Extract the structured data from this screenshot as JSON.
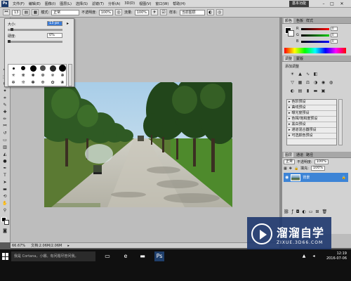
{
  "menubar": {
    "logo": "Ps",
    "items": [
      "文件(F)",
      "编辑(E)",
      "图像(I)",
      "图层(L)",
      "选择(S)",
      "滤镜(T)",
      "分析(A)",
      "3D(D)",
      "视图(V)",
      "窗口(W)",
      "帮助(H)"
    ],
    "workspace": "基本功能",
    "win_min": "–",
    "win_max": "□",
    "win_close": "✕"
  },
  "options": {
    "brush_size": "13",
    "mode_label": "模式:",
    "mode_value": "正常",
    "opacity_label": "不透明度:",
    "opacity_value": "100%",
    "flow_label": "流量:",
    "flow_value": "100%",
    "sample_label": "样本:",
    "sample_value": "当前图层"
  },
  "brush_popup": {
    "size_label": "大小:",
    "size_value": "13 px",
    "hardness_label": "硬度:",
    "hardness_value": "0%",
    "size_fraction": 0.05,
    "hardness_fraction": 0.0
  },
  "color_panel": {
    "tabs": [
      "颜色",
      "色板",
      "样式"
    ],
    "r_label": "R",
    "r_value": "0",
    "g_label": "G",
    "g_value": "0",
    "b_label": "B",
    "b_value": "0"
  },
  "adjust_panel": {
    "tabs": [
      "调整",
      "蒙版"
    ],
    "title": "添加调整",
    "presets": [
      "色阶预设",
      "曲线预设",
      "曝光度预设",
      "色相/饱和度预设",
      "黑白预设",
      "通道混合器预设",
      "可选颜色预设"
    ]
  },
  "layers_panel": {
    "tabs": [
      "图层",
      "通道",
      "路径"
    ],
    "mode": "正常",
    "opacity_label": "不透明度:",
    "opacity_value": "100%",
    "fill_label": "填充:",
    "fill_value": "100%",
    "layer_name": "背景",
    "layer_lock": "🔒"
  },
  "status": {
    "zoom": "66.67%",
    "doc_info": "文档:2.06M/2.06M"
  },
  "watermark": {
    "main": "溜溜自学",
    "sub": "ZIXUE.3D66.COM"
  },
  "taskbar": {
    "search_placeholder": "我是 Cortana，小娜。有问题尽管问我。",
    "time": "12:19",
    "date": "2016-07-06"
  },
  "colors": {
    "selection_blue": "#3d84d6",
    "watermark_bg": "#1e376e"
  }
}
